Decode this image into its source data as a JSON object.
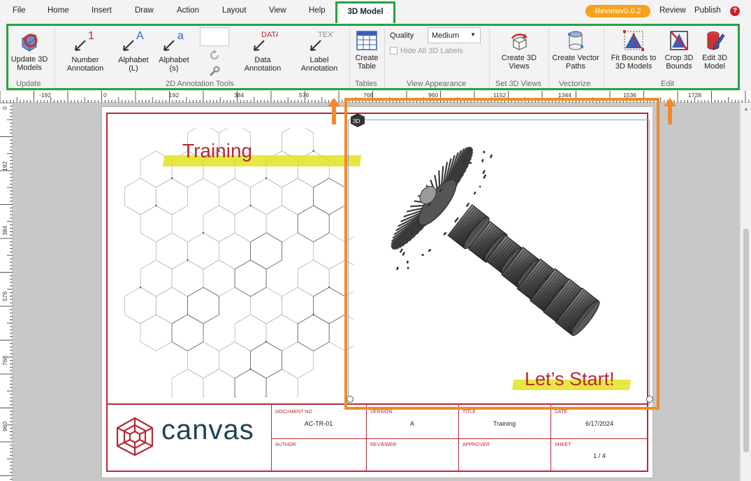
{
  "menu": {
    "items": [
      "File",
      "Home",
      "Insert",
      "Draw",
      "Action",
      "Layout",
      "View",
      "Help"
    ],
    "active_tab": "3D Model",
    "review_badge": "Reviewv0.0.2",
    "review": "Review",
    "publish": "Publish",
    "help_icon": "?"
  },
  "ribbon": {
    "update_models": "Update 3D Models",
    "number_annotation": "Number Annotation",
    "alphabet_upper": "Alphabet (L)",
    "alphabet_lower": "Alphabet (s)",
    "data_annotation": "Data Annotation",
    "label_annotation": "Label Annotation",
    "create_table": "Create Table",
    "quality_label": "Quality",
    "quality_value": "Medium",
    "hide_labels": "Hide All 3D Labels",
    "create_views": "Create 3D Views",
    "create_vector": "Create Vector Paths",
    "fit_bounds": "Fit Bounds to 3D Models",
    "crop_bounds": "Crop 3D Bounds",
    "edit_model": "Edit 3D Model",
    "icon_texts": {
      "number": "1",
      "alpha_upper": "A",
      "alpha_lower": "a",
      "data": "DATA",
      "text": "TEXT"
    },
    "groups": {
      "update": "Update",
      "annotation_tools": "2D Annotation Tools",
      "tables": "Tables",
      "view_appearance": "View Appearance",
      "set_views": "Set 3D Views",
      "vectorize": "Vectorize",
      "edit": "Edit"
    }
  },
  "rulers": {
    "horizontal": [
      "-192",
      "0",
      "192",
      "384",
      "576",
      "768",
      "960",
      "1152",
      "1344",
      "1536",
      "1728"
    ],
    "vertical": [
      "0",
      "192",
      "384",
      "576",
      "768",
      "960"
    ]
  },
  "drawing": {
    "title_text": "Training",
    "start_text": "Let’s Start!",
    "logo_text": "canvas",
    "cube_badge": "3D",
    "title_block": {
      "document_no_label": "DOCUMENT NO",
      "document_no": "AC-TR-01",
      "version_label": "VERSION",
      "version": "A",
      "title_label": "TITLE",
      "title": "Training",
      "date_label": "DATE",
      "date": "6/17/2024",
      "author_label": "AUTHOR",
      "reviewer_label": "REVIEWER",
      "approver_label": "APPROVER",
      "sheet_label": "SHEET",
      "sheet": "1 / 4"
    }
  },
  "colors": {
    "accent_green": "#27a243",
    "accent_orange": "#f28a2c",
    "brand_red": "#b52a35",
    "highlight_yellow": "#e3e320",
    "logo_teal": "#1e4452"
  }
}
